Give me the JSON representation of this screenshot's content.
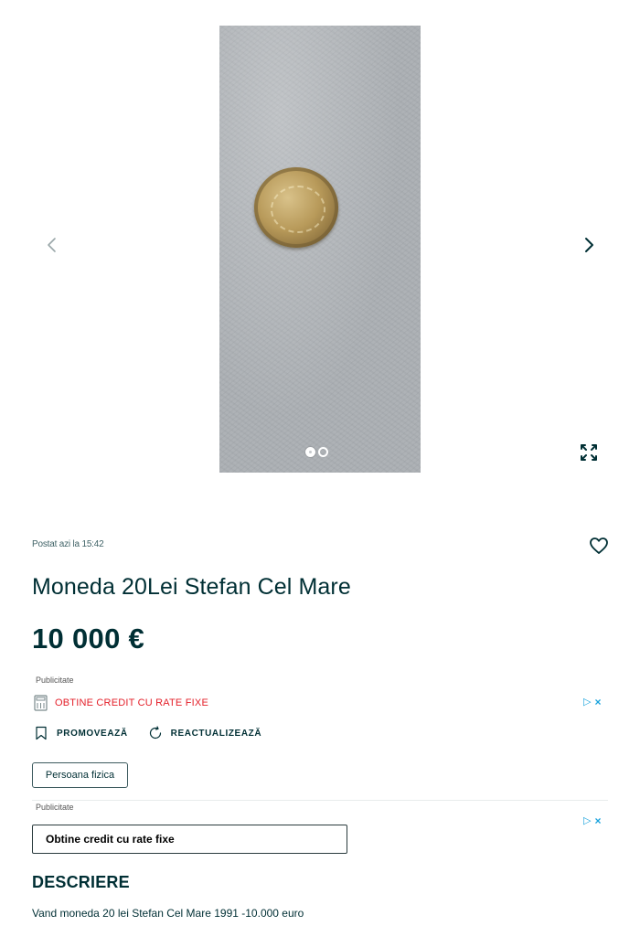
{
  "gallery": {
    "photo_alt": "coin-photo",
    "dots_total": 2,
    "dots_active": 1
  },
  "listing": {
    "posted": "Postat azi la 15:42",
    "title": "Moneda 20Lei Stefan Cel Mare",
    "price": "10 000 €"
  },
  "ads": {
    "label": "Publicitate",
    "credit_link": "OBTINE CREDIT CU RATE FIXE",
    "credit_box": "Obtine credit cu rate fixe"
  },
  "actions": {
    "promote": "PROMOVEAZĂ",
    "refresh": "REACTUALIZEAZĂ"
  },
  "seller_type": "Persoana fizica",
  "description": {
    "heading": "DESCRIERE",
    "text": "Vand moneda 20 lei Stefan Cel Mare 1991 -10.000 euro"
  },
  "colors": {
    "text": "#002f34",
    "ad_red": "#e4202a",
    "adchoice_blue": "#1aa3dd"
  }
}
